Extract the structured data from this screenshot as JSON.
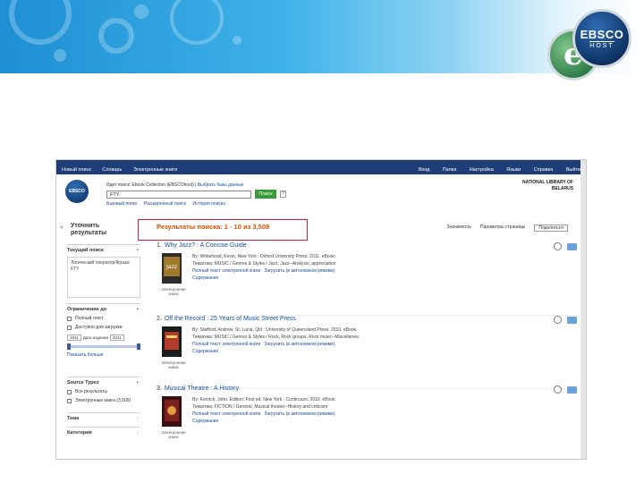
{
  "logo": {
    "e": "e",
    "line1": "EBSCO",
    "line2": "HOST"
  },
  "topbar": {
    "left": [
      "Новый поиск",
      "Словарь",
      "Электронные книги"
    ],
    "right": [
      "Вход",
      "Папка",
      "Настройка",
      "Языки",
      "Справка",
      "Выйти"
    ]
  },
  "search": {
    "db_prefix": "Идет поиск: Ebook Collection (EBSCOhost)",
    "db_link": "Выбрать базы данных",
    "value": "FTY",
    "button": "Поиск",
    "help": "?",
    "sublinks": [
      "Базовый поиск",
      "Расширенный поиск",
      "История поиска"
    ],
    "library": "NATIONAL LIBRARY OF BELARUS",
    "mini_logo": "EBSCO"
  },
  "sidebar": {
    "collapse": "«",
    "refine_title": "Уточнить результаты",
    "current_search": {
      "heading": "Текущий поиск",
      "box": "Логический оператор/Фраза: FTY"
    },
    "limit_to": {
      "heading": "Ограничение до",
      "options": [
        "Полный текст",
        "Доступно для загрузки"
      ],
      "date_from": "1911",
      "date_label": "Дата издания",
      "date_to": "2011",
      "more": "Показать больше"
    },
    "source_types": {
      "heading": "Source Types",
      "options": [
        "Все результаты",
        "Электронные книги (3,509)"
      ]
    },
    "subject": {
      "heading": "Тема"
    },
    "category": {
      "heading": "Категория"
    }
  },
  "results": {
    "header": "Результаты поиска: 1 - 10 из 3,509",
    "toolbar": [
      "Значимость",
      "Параметры страницы",
      "Поделиться"
    ],
    "items": [
      {
        "num": "1.",
        "title": "Why Jazz? : A Concise Guide",
        "line1": "By: Whitehead, Kevin. New York : Oxford University Press. 2011. eBook.",
        "line2": "Тематика: MUSIC / Genres & Styles / Jazz, Jazz--Analysis, appreciation",
        "link1": "Полный текст электронной книги",
        "link2": "Загрузить (в автономном режиме)",
        "link3": "Содержание",
        "type": "Электронная книга"
      },
      {
        "num": "2.",
        "title": "Off the Record : 25 Years of Music Street Press",
        "line1": "By: Stafford, Andrew. St. Lucia, Qld : University of Queensland Press. 2010. eBook.",
        "line2": "Тематика: MUSIC / Genres & Styles / Rock, Rock groups, Rock music--Miscellanea",
        "link1": "Полный текст электронной книги",
        "link2": "Загрузить (в автономном режиме)",
        "link3": "Содержание",
        "type": "Электронная книга"
      },
      {
        "num": "3.",
        "title": "Musical Theatre : A History",
        "line1": "By: Kenrick, John. Edition: First ed. New York : Continuum. 2010. eBook.",
        "line2": "Тематика: FICTION / General, Musical theater--History and criticism",
        "link1": "Полный текст электронной книги",
        "link2": "Загрузить (в автономном режиме)",
        "link3": "Содержание",
        "type": "Электронная книга"
      }
    ]
  },
  "colors": {
    "topbar": "#1f3e78",
    "highlight_box": "#d01f2f",
    "results_header": "#d24d00",
    "link": "#1a4fa0"
  }
}
